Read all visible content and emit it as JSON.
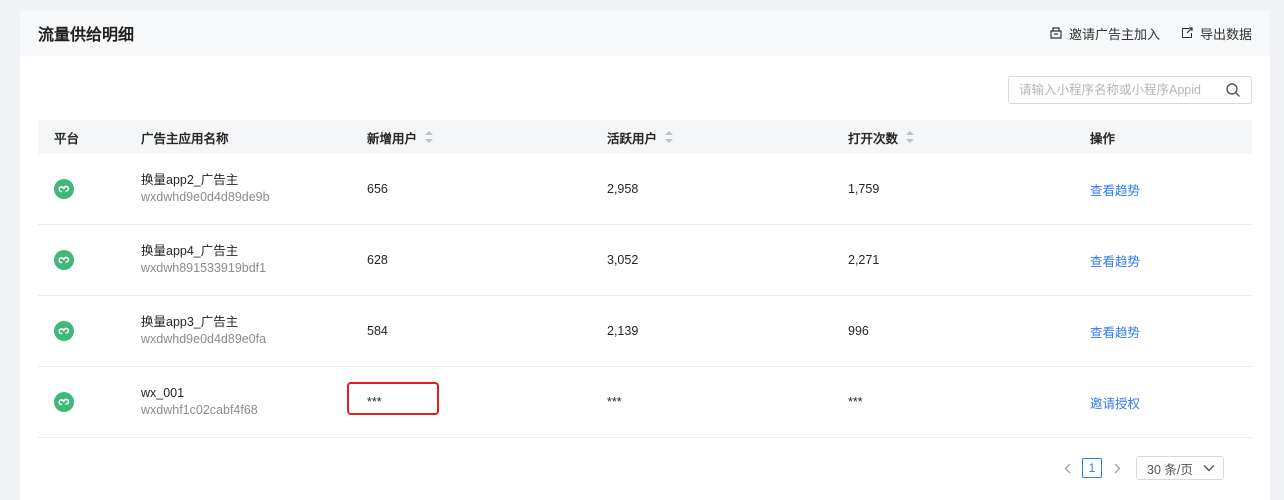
{
  "header": {
    "title": "流量供给明细",
    "invite_label": "邀请广告主加入",
    "export_label": "导出数据"
  },
  "search": {
    "placeholder": "请输入小程序名称或小程序Appid",
    "value": ""
  },
  "table": {
    "columns": [
      "平台",
      "广告主应用名称",
      "新增用户",
      "活跃用户",
      "打开次数",
      "操作"
    ],
    "rows": [
      {
        "platform_icon": "wechat-miniprogram-icon",
        "name": "换量app2_广告主",
        "appid": "wxdwhd9e0d4d89de9b",
        "new_users": "656",
        "active_users": "2,958",
        "opens": "1,759",
        "action": "查看趋势"
      },
      {
        "platform_icon": "wechat-miniprogram-icon",
        "name": "换量app4_广告主",
        "appid": "wxdwh891533919bdf1",
        "new_users": "628",
        "active_users": "3,052",
        "opens": "2,271",
        "action": "查看趋势"
      },
      {
        "platform_icon": "wechat-miniprogram-icon",
        "name": "换量app3_广告主",
        "appid": "wxdwhd9e0d4d89e0fa",
        "new_users": "584",
        "active_users": "2,139",
        "opens": "996",
        "action": "查看趋势"
      },
      {
        "platform_icon": "wechat-miniprogram-icon",
        "name": "wx_001",
        "appid": "wxdwhf1c02cabf4f68",
        "new_users": "***",
        "active_users": "***",
        "opens": "***",
        "action": "邀请授权"
      }
    ]
  },
  "pagination": {
    "current_page": "1",
    "page_size_label": "30 条/页"
  },
  "colors": {
    "accent": "#2f7bf0",
    "platform_icon": "#3fb87a",
    "highlight": "#e02020"
  }
}
